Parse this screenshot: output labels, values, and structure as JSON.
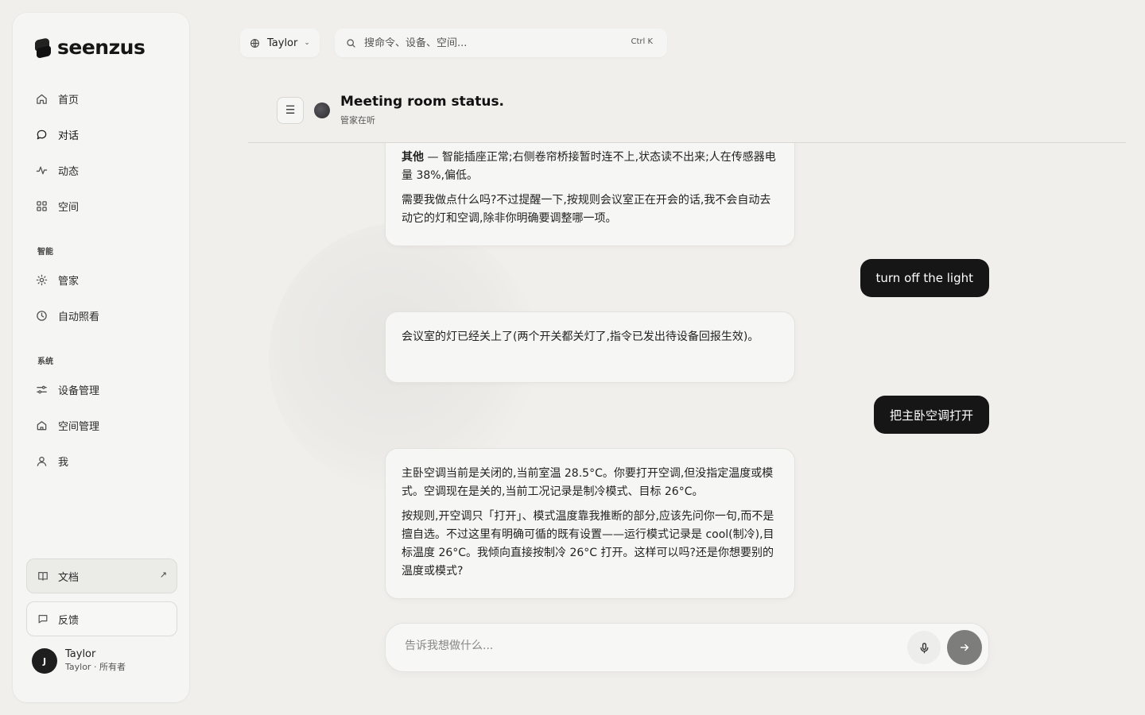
{
  "brand": {
    "name": "seenzus"
  },
  "nav": {
    "items": [
      {
        "label": "首页",
        "icon": "home-icon"
      },
      {
        "label": "对话",
        "icon": "chat-icon"
      },
      {
        "label": "动态",
        "icon": "activity-icon"
      },
      {
        "label": "空间",
        "icon": "grid-icon"
      }
    ],
    "section_smart": "智能",
    "smart_items": [
      {
        "label": "管家",
        "icon": "sun-icon"
      },
      {
        "label": "自动照看",
        "icon": "clock-icon"
      }
    ],
    "section_system": "系统",
    "system_items": [
      {
        "label": "设备管理",
        "icon": "sliders-icon"
      },
      {
        "label": "空间管理",
        "icon": "house-icon"
      },
      {
        "label": "我",
        "icon": "user-icon"
      }
    ]
  },
  "sidebar_bottom": {
    "docs_label": "文档",
    "docs_ext": "↗",
    "feedback_label": "反馈"
  },
  "user": {
    "initial": "J",
    "name": "Taylor",
    "role": "Taylor · 所有者"
  },
  "topbar": {
    "workspace": "Taylor",
    "search_placeholder": "搜命令、设备、空间...",
    "search_shortcut": "Ctrl K"
  },
  "conversation": {
    "title": "Meeting room status.",
    "subtitle": "管家在听"
  },
  "messages": {
    "m1_p1_bold": "其他",
    "m1_p1_rest": " — 智能插座正常;右侧卷帘桥接暂时连不上,状态读不出来;人在传感器电量 38%,偏低。",
    "m1_p2": "需要我做点什么吗?不过提醒一下,按规则会议室正在开会的话,我不会自动去动它的灯和空调,除非你明确要调整哪一项。",
    "u1": "turn off the light",
    "m2": "会议室的灯已经关上了(两个开关都关灯了,指令已发出待设备回报生效)。",
    "u2": "把主卧空调打开",
    "m3_p1": "主卧空调当前是关闭的,当前室温 28.5°C。你要打开空调,但没指定温度或模式。空调现在是关的,当前工况记录是制冷模式、目标 26°C。",
    "m3_p2": "按规则,开空调只「打开」、模式温度靠我推断的部分,应该先问你一句,而不是擅自选。不过这里有明确可循的既有设置——运行模式记录是 cool(制冷),目标温度 26°C。我倾向直接按制冷 26°C 打开。这样可以吗?还是你想要别的温度或模式?"
  },
  "composer": {
    "placeholder": "告诉我想做什么..."
  }
}
